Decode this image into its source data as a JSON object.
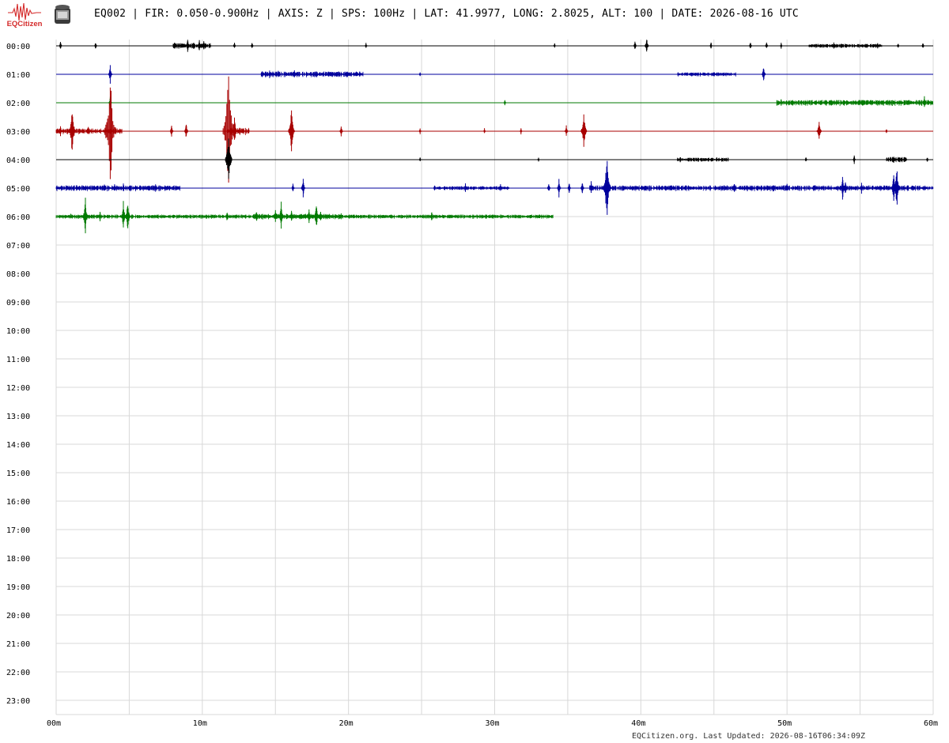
{
  "header": {
    "logo_text": "EQCitizen",
    "title": "EQ002 | FIR: 0.050-0.900Hz | AXIS: Z | SPS: 100Hz | LAT: 41.9977, LONG: 2.8025, ALT: 100 | DATE: 2026-08-16 UTC"
  },
  "footer": {
    "text": "EQCitizen.org. Last Updated: 2026-08-16T06:34:09Z"
  },
  "colors": {
    "black": "#000000",
    "blue": "#00009c",
    "green": "#007a00",
    "red": "#a80000",
    "grid": "#d8d8d8",
    "logo_red": "#d42a2a"
  },
  "chart_data": {
    "type": "line",
    "title": "",
    "xlabel": "",
    "ylabel": "",
    "x_unit": "minutes",
    "xlim": [
      0,
      60
    ],
    "x_ticks": [
      0,
      10,
      20,
      30,
      40,
      50,
      60
    ],
    "x_tick_labels": [
      "00m",
      "10m",
      "20m",
      "30m",
      "40m",
      "50m",
      "60m"
    ],
    "rows": [
      "00:00",
      "01:00",
      "02:00",
      "03:00",
      "04:00",
      "05:00",
      "06:00",
      "07:00",
      "08:00",
      "09:00",
      "10:00",
      "11:00",
      "12:00",
      "13:00",
      "14:00",
      "15:00",
      "16:00",
      "17:00",
      "18:00",
      "19:00",
      "20:00",
      "21:00",
      "22:00",
      "23:00"
    ],
    "grid": true,
    "series": [
      {
        "row": "00:00",
        "color": "#000000",
        "end_min": 60,
        "events": [
          [
            0.3,
            6
          ],
          [
            2.7,
            5
          ],
          [
            8.1,
            6
          ],
          [
            9.0,
            9
          ],
          [
            9.4,
            6
          ],
          [
            9.8,
            8
          ],
          [
            10.1,
            7
          ],
          [
            12.2,
            5
          ],
          [
            13.4,
            5
          ],
          [
            21.2,
            4
          ],
          [
            34.1,
            4
          ],
          [
            39.6,
            7
          ],
          [
            40.4,
            12
          ],
          [
            44.8,
            5
          ],
          [
            47.5,
            6
          ],
          [
            48.6,
            5
          ],
          [
            49.6,
            4
          ],
          [
            53.2,
            5
          ],
          [
            56.2,
            4
          ],
          [
            57.6,
            4
          ],
          [
            59.3,
            5
          ]
        ],
        "noise": [
          [
            8.0,
            10.6,
            3
          ],
          [
            51.5,
            56.5,
            2
          ]
        ]
      },
      {
        "row": "01:00",
        "color": "#00009c",
        "end_min": 60,
        "events": [
          [
            3.7,
            12
          ],
          [
            14.1,
            6
          ],
          [
            14.6,
            5
          ],
          [
            15.2,
            5
          ],
          [
            16.3,
            5
          ],
          [
            17.6,
            4
          ],
          [
            19.2,
            4
          ],
          [
            24.9,
            3
          ],
          [
            43.5,
            3
          ],
          [
            48.4,
            12
          ]
        ],
        "noise": [
          [
            14.0,
            21.0,
            3
          ],
          [
            42.5,
            46.5,
            2
          ]
        ]
      },
      {
        "row": "02:00",
        "color": "#007a00",
        "end_min": 60,
        "events": [
          [
            3.7,
            8
          ],
          [
            30.7,
            4
          ],
          [
            49.6,
            6
          ],
          [
            50.4,
            4
          ],
          [
            53.0,
            5
          ],
          [
            57.0,
            3
          ],
          [
            58.2,
            4
          ],
          [
            59.4,
            9
          ]
        ],
        "noise": [
          [
            49.3,
            60.0,
            3
          ]
        ]
      },
      {
        "row": "03:00",
        "color": "#a80000",
        "end_min": 60,
        "events": [
          [
            0.3,
            7
          ],
          [
            1.1,
            36
          ],
          [
            1.6,
            5
          ],
          [
            2.2,
            8
          ],
          [
            3.7,
            85
          ],
          [
            7.9,
            9
          ],
          [
            8.9,
            12
          ],
          [
            11.8,
            90
          ],
          [
            12.2,
            22
          ],
          [
            16.1,
            34
          ],
          [
            19.5,
            8
          ],
          [
            24.9,
            4
          ],
          [
            29.3,
            4
          ],
          [
            31.8,
            4
          ],
          [
            34.9,
            8
          ],
          [
            36.1,
            30
          ],
          [
            52.2,
            18
          ],
          [
            56.8,
            4
          ]
        ],
        "noise": [
          [
            0.0,
            4.5,
            3
          ],
          [
            11.7,
            13.2,
            4
          ]
        ]
      },
      {
        "row": "04:00",
        "color": "#000000",
        "end_min": 60,
        "events": [
          [
            11.8,
            40
          ],
          [
            24.9,
            3
          ],
          [
            33.0,
            3
          ],
          [
            42.7,
            5
          ],
          [
            45.2,
            3
          ],
          [
            51.3,
            4
          ],
          [
            54.6,
            6
          ],
          [
            57.3,
            6
          ],
          [
            57.7,
            4
          ],
          [
            59.6,
            4
          ]
        ],
        "noise": [
          [
            42.5,
            46.0,
            2
          ],
          [
            56.8,
            58.2,
            3
          ]
        ]
      },
      {
        "row": "05:00",
        "color": "#00009c",
        "end_min": 60,
        "events": [
          [
            1.4,
            6
          ],
          [
            3.3,
            5
          ],
          [
            4.0,
            6
          ],
          [
            4.6,
            8
          ],
          [
            6.8,
            5
          ],
          [
            8.2,
            5
          ],
          [
            16.2,
            6
          ],
          [
            16.9,
            14
          ],
          [
            25.9,
            5
          ],
          [
            28.0,
            6
          ],
          [
            30.4,
            6
          ],
          [
            33.7,
            8
          ],
          [
            34.4,
            12
          ],
          [
            35.1,
            8
          ],
          [
            36.0,
            10
          ],
          [
            36.6,
            9
          ],
          [
            37.6,
            26
          ],
          [
            37.7,
            44
          ],
          [
            46.4,
            9
          ],
          [
            50.0,
            6
          ],
          [
            53.8,
            16
          ],
          [
            54.0,
            10
          ],
          [
            55.1,
            7
          ],
          [
            57.3,
            22
          ],
          [
            57.5,
            34
          ]
        ],
        "noise": [
          [
            0.0,
            8.5,
            3
          ],
          [
            36.5,
            60.0,
            3
          ],
          [
            26.0,
            31.0,
            2
          ]
        ]
      },
      {
        "row": "06:00",
        "color": "#007a00",
        "end_min": 34,
        "events": [
          [
            1.0,
            5
          ],
          [
            2.0,
            26
          ],
          [
            3.0,
            7
          ],
          [
            4.6,
            20
          ],
          [
            4.9,
            24
          ],
          [
            11.7,
            8
          ],
          [
            13.7,
            8
          ],
          [
            15.0,
            11
          ],
          [
            15.4,
            20
          ],
          [
            16.1,
            8
          ],
          [
            17.3,
            12
          ],
          [
            17.8,
            20
          ],
          [
            18.1,
            8
          ],
          [
            19.5,
            5
          ],
          [
            25.7,
            8
          ]
        ],
        "noise": [
          [
            0.0,
            34.0,
            2
          ],
          [
            13.5,
            19.5,
            3
          ]
        ]
      }
    ]
  }
}
